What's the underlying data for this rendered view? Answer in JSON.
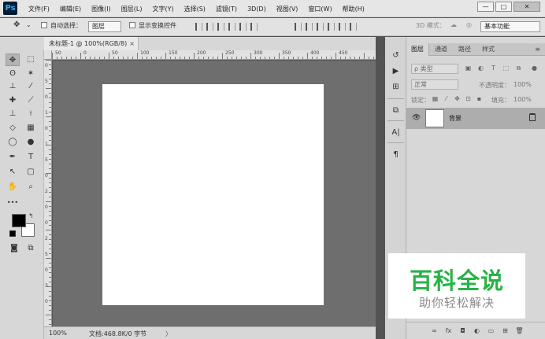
{
  "app": {
    "logo": "Ps",
    "menu": [
      "文件(F)",
      "编辑(E)",
      "图像(I)",
      "图层(L)",
      "文字(Y)",
      "选择(S)",
      "滤镜(T)",
      "3D(D)",
      "视图(V)",
      "窗口(W)",
      "帮助(H)"
    ],
    "window_controls": {
      "minimize": "—",
      "maximize": "□",
      "close": "✕"
    }
  },
  "options_bar": {
    "tool_glyph": "✥",
    "auto_select_label": "自动选择：",
    "auto_select_value": "图层",
    "show_transform_label": "显示变换控件",
    "mode_3d_label": "3D 模式：",
    "workspace_value": "基本功能"
  },
  "document": {
    "tab_title": "未标题-1 @ 100%(RGB/8)",
    "tab_close": "×",
    "ruler_top_ticks": [
      "50",
      "0",
      "50",
      "100",
      "150",
      "200",
      "250",
      "300",
      "350",
      "400",
      "450"
    ],
    "ruler_left_ticks": [
      "0",
      "5",
      "0",
      "1",
      "0",
      "1",
      "5",
      "0",
      "2",
      "0",
      "0",
      "2",
      "5",
      "0",
      "3",
      "0"
    ]
  },
  "status_bar": {
    "zoom": "100%",
    "doc_info": "文档:468.8K/0 字节",
    "arrow": "〉"
  },
  "toolbar": {
    "tools": [
      {
        "name": "move-tool",
        "glyph": "✥"
      },
      {
        "name": "marquee-tool",
        "glyph": "⬚"
      },
      {
        "name": "lasso-tool",
        "glyph": "ʘ"
      },
      {
        "name": "magic-wand-tool",
        "glyph": "✶"
      },
      {
        "name": "crop-tool",
        "glyph": "⊥"
      },
      {
        "name": "eyedropper-tool",
        "glyph": "⁄"
      },
      {
        "name": "healing-brush-tool",
        "glyph": "✚"
      },
      {
        "name": "brush-tool",
        "glyph": "⟋"
      },
      {
        "name": "clone-stamp-tool",
        "glyph": "⊥"
      },
      {
        "name": "history-brush-tool",
        "glyph": "⟊"
      },
      {
        "name": "eraser-tool",
        "glyph": "◇"
      },
      {
        "name": "gradient-tool",
        "glyph": "▦"
      },
      {
        "name": "blur-tool",
        "glyph": "◯"
      },
      {
        "name": "dodge-tool",
        "glyph": "●"
      },
      {
        "name": "pen-tool",
        "glyph": "✒"
      },
      {
        "name": "type-tool",
        "glyph": "T"
      },
      {
        "name": "path-selection-tool",
        "glyph": "↖"
      },
      {
        "name": "shape-tool",
        "glyph": "▢"
      },
      {
        "name": "hand-tool",
        "glyph": "✋"
      },
      {
        "name": "zoom-tool",
        "glyph": "⌕"
      },
      {
        "name": "more-tools",
        "glyph": "•••"
      },
      {
        "name": "quick-mask-tool",
        "glyph": "◙"
      },
      {
        "name": "screen-mode-tool",
        "glyph": "⧉"
      }
    ],
    "swap_glyph": "↰",
    "foreground_color": "#000000",
    "background_color": "#ffffff"
  },
  "icon_dock": {
    "icons": [
      {
        "name": "history-panel-icon",
        "glyph": "↺"
      },
      {
        "name": "actions-panel-icon",
        "glyph": "▶"
      },
      {
        "name": "brush-settings-panel-icon",
        "glyph": "⊞"
      },
      {
        "name": "clone-source-panel-icon",
        "glyph": "⧉"
      },
      {
        "name": "character-panel-icon",
        "glyph": "A|"
      },
      {
        "name": "paragraph-panel-icon",
        "glyph": "¶"
      }
    ]
  },
  "layers_panel": {
    "tabs": [
      "图层",
      "通道",
      "路径",
      "样式"
    ],
    "menu_glyph": "≡",
    "filter_placeholder": "ρ 类型",
    "blend_mode": "正常",
    "opacity_label": "不透明度：",
    "opacity_value": "100%",
    "lock_label": "锁定：",
    "fill_label": "填充：",
    "fill_value": "100%",
    "layer_eye": "👁",
    "layer_name": "背景",
    "footer_glyphs": [
      "∞",
      "fx",
      "◘",
      "◐",
      "▭",
      "⊞",
      "🗑"
    ]
  },
  "watermark": {
    "title": "百科全说",
    "subtitle": "助你轻松解决"
  }
}
